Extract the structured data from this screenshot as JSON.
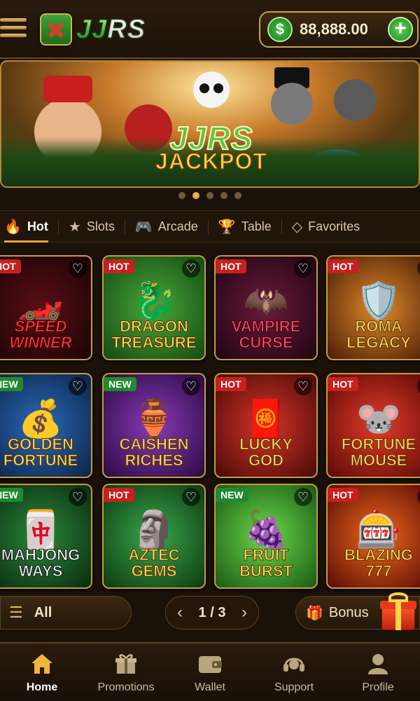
{
  "header": {
    "logo_text_main": "JJ",
    "logo_text_accent": "RS",
    "balance": "88,888.00",
    "currency_symbol": "$",
    "add_symbol": "+"
  },
  "banner": {
    "line1": "JJRS",
    "line2": "JACKPOT",
    "slide_count": 5,
    "active_slide": 2
  },
  "tabs": [
    {
      "label": "Hot",
      "icon": "flame-icon",
      "active": true
    },
    {
      "label": "Slots",
      "icon": "star-icon",
      "active": false
    },
    {
      "label": "Arcade",
      "icon": "gamepad-icon",
      "active": false
    },
    {
      "label": "Table",
      "icon": "trophy-icon",
      "active": false
    },
    {
      "label": "Favorites",
      "icon": "diamond-icon",
      "active": false
    }
  ],
  "games": [
    {
      "line1": "SPEED",
      "line2": "WINNER",
      "badge": "HOT"
    },
    {
      "line1": "DRAGON",
      "line2": "TREASURE",
      "badge": "HOT"
    },
    {
      "line1": "VAMPIRE",
      "line2": "CURSE",
      "badge": "HOT"
    },
    {
      "line1": "ROMA",
      "line2": "LEGACY",
      "badge": "HOT"
    },
    {
      "line1": "GOLDEN",
      "line2": "FORTUNE",
      "badge": "NEW"
    },
    {
      "line1": "CAISHEN",
      "line2": "RICHES",
      "badge": "NEW"
    },
    {
      "line1": "LUCKY",
      "line2": "GOD",
      "badge": "HOT"
    },
    {
      "line1": "FORTUNE",
      "line2": "MOUSE",
      "badge": "HOT"
    },
    {
      "line1": "MAHJONG",
      "line2": "WAYS",
      "badge": "NEW"
    },
    {
      "line1": "AZTEC",
      "line2": "GEMS",
      "badge": "HOT"
    },
    {
      "line1": "FRUIT",
      "line2": "BURST",
      "badge": "NEW"
    },
    {
      "line1": "BLAZING",
      "line2": "777",
      "badge": "HOT"
    }
  ],
  "actions": {
    "all_label": "All",
    "page_indicator": "1 / 3",
    "prev_symbol": "‹",
    "next_symbol": "›",
    "bonus_label": "Bonus"
  },
  "nav": [
    {
      "label": "Home",
      "icon": "home-icon",
      "active": true
    },
    {
      "label": "Promotions",
      "icon": "gift-icon",
      "active": false
    },
    {
      "label": "Wallet",
      "icon": "wallet-icon",
      "active": false
    },
    {
      "label": "Support",
      "icon": "headset-icon",
      "active": false
    },
    {
      "label": "Profile",
      "icon": "user-icon",
      "active": false
    }
  ],
  "colors": {
    "accent_gold": "#e9b33e",
    "hot_badge": "#c8201e",
    "new_badge": "#1f8a2f",
    "background": "#1a1109"
  }
}
